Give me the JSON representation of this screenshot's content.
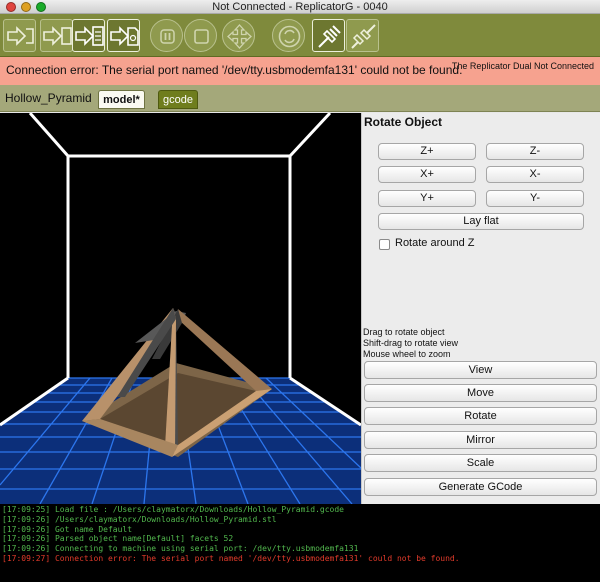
{
  "window": {
    "title": "Not Connected - ReplicatorG - 0040"
  },
  "toolbar": {
    "buttons": [
      {
        "name": "build-to-machine-button",
        "icon": "build-icon"
      },
      {
        "name": "build-to-file-button",
        "icon": "build-file-icon"
      },
      {
        "name": "upload-button",
        "icon": "upload-icon"
      },
      {
        "name": "build-to-sd-button",
        "icon": "sd-card-icon"
      },
      {
        "name": "pause-button",
        "icon": "pause-icon"
      },
      {
        "name": "stop-button",
        "icon": "stop-icon"
      },
      {
        "name": "control-panel-button",
        "icon": "move-arrows-icon"
      },
      {
        "name": "reset-button",
        "icon": "reset-icon"
      },
      {
        "name": "connect-button",
        "icon": "connect-icon"
      },
      {
        "name": "disconnect-button",
        "icon": "disconnect-icon"
      }
    ]
  },
  "error_bar": {
    "message": "Connection error: The serial port named '/dev/tty.usbmodemfa131' could not be found.",
    "status": "The Replicator Dual Not Connected"
  },
  "tabs": {
    "file_name": "Hollow_Pyramid",
    "model_label": "model*",
    "gcode_label": "gcode"
  },
  "panel": {
    "title": "Rotate Object",
    "z_plus": "Z+",
    "z_minus": "Z-",
    "x_plus": "X+",
    "x_minus": "X-",
    "y_plus": "Y+",
    "y_minus": "Y-",
    "lay_flat": "Lay flat",
    "rotate_around_z": "Rotate around Z",
    "hint_drag": "Drag to rotate object",
    "hint_shift": "Shift-drag to rotate view",
    "hint_wheel": "Mouse wheel to zoom",
    "view": "View",
    "move": "Move",
    "rotate": "Rotate",
    "mirror": "Mirror",
    "scale": "Scale",
    "generate": "Generate GCode"
  },
  "console": {
    "lines": [
      {
        "text": "[17:09:25] Load file : /Users/claymatorx/Downloads/Hollow_Pyramid.gcode",
        "type": "normal"
      },
      {
        "text": "[17:09:26] /Users/claymatorx/Downloads/Hollow_Pyramid.stl",
        "type": "normal"
      },
      {
        "text": "[17:09:26] Got name Default",
        "type": "normal"
      },
      {
        "text": "[17:09:26] Parsed object name[Default] facets 52",
        "type": "normal"
      },
      {
        "text": "[17:09:26] Connecting to machine using serial port: /dev/tty.usbmodemfa131",
        "type": "normal"
      },
      {
        "text": "[17:09:27] Connection error: The serial port named '/dev/tty.usbmodemfa131' could not be found.",
        "type": "error"
      }
    ]
  },
  "colors": {
    "toolbar_bg": "#7f8a3c",
    "error_bg": "#f6a28f",
    "tab_bar_bg": "#a4a87a",
    "console_text": "#52b84e",
    "console_error": "#e23b2b",
    "build_volume_lines": "#ffffff",
    "platform_grid": "#1e66d8",
    "model_color": "#b8916a"
  }
}
